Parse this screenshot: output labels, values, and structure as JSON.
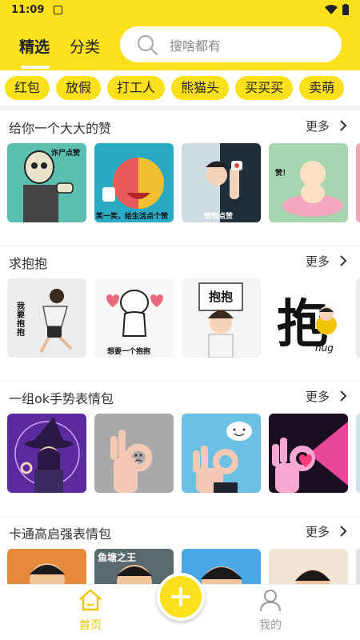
{
  "status_bar": {
    "time": "11:09"
  },
  "header": {
    "tabs": [
      {
        "label": "精选"
      },
      {
        "label": "分类"
      }
    ],
    "search": {
      "placeholder": "搜啥都有"
    }
  },
  "chips": [
    "红包",
    "放假",
    "打工人",
    "熊猫头",
    "买买买",
    "卖萌"
  ],
  "sections": [
    {
      "title": "给你一个大大的赞",
      "more": "更多",
      "captions": [
        "诈尸点赞",
        "笑一笑，给生活点个赞",
        "悄悄点赞",
        "赞！"
      ]
    },
    {
      "title": "求抱抱",
      "more": "更多",
      "captions": [
        "我要抱抱",
        "想要一个抱抱",
        "抱抱",
        "抱",
        "hug"
      ]
    },
    {
      "title": "一组ok手势表情包",
      "more": "更多",
      "captions": []
    },
    {
      "title": "卡通高启强表情包",
      "more": "更多",
      "captions": [
        "鱼塘之王"
      ]
    }
  ],
  "bottom_nav": {
    "home": "首页",
    "mine": "我的"
  },
  "colors": {
    "brand": "#fde01c",
    "active_nav": "#f0c400"
  }
}
